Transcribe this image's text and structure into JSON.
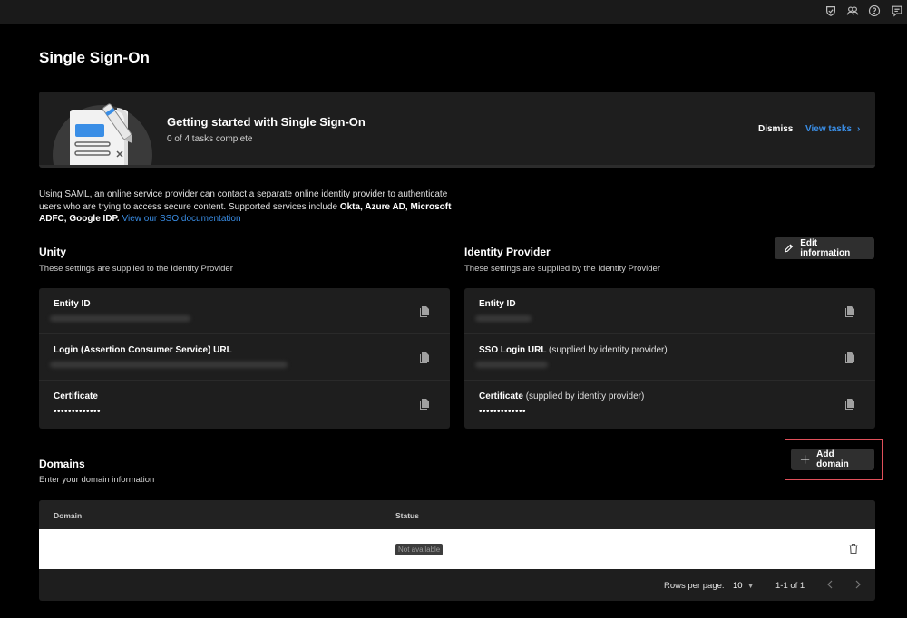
{
  "topbar": {
    "icons": [
      "shield-check-icon",
      "users-icon",
      "help-icon",
      "message-icon"
    ]
  },
  "page": {
    "title": "Single Sign-On"
  },
  "banner": {
    "title": "Getting started with Single Sign-On",
    "progress": "0 of 4 tasks complete",
    "dismiss": "Dismiss",
    "view_tasks": "View tasks"
  },
  "intro": {
    "text": "Using SAML, an online service provider can contact a separate online identity provider to authenticate users who are trying to access secure content. Supported services include ",
    "services": "Okta, Azure AD, Microsoft ADFC, Google IDP.",
    "link": "View our SSO documentation"
  },
  "unity": {
    "title": "Unity",
    "subtitle": "These settings are supplied to the Identity Provider",
    "fields": [
      {
        "label": "Entity ID",
        "note": ""
      },
      {
        "label": "Login (Assertion Consumer Service) URL",
        "note": ""
      },
      {
        "label": "Certificate",
        "note": "",
        "value": "•••••••••••••"
      }
    ]
  },
  "idp": {
    "title": "Identity Provider",
    "subtitle": "These settings are supplied by the Identity Provider",
    "edit_button": "Edit information",
    "fields": [
      {
        "label": "Entity ID",
        "note": ""
      },
      {
        "label": "SSO Login URL",
        "note": "(supplied by identity provider)"
      },
      {
        "label": "Certificate",
        "note": "(supplied by identity provider)",
        "value": "•••••••••••••"
      }
    ]
  },
  "domains": {
    "title": "Domains",
    "subtitle": "Enter your domain information",
    "add_button": "Add domain",
    "columns": [
      "Domain",
      "Status"
    ],
    "rows": [
      {
        "domain": "",
        "status": "Not available"
      }
    ],
    "rows_per_page_label": "Rows per page:",
    "rows_per_page": "10",
    "range": "1-1 of 1"
  },
  "colors": {
    "accent": "#3a8ee6",
    "highlight": "#e0505a",
    "surface": "#1e1e1e",
    "background": "#000000"
  }
}
